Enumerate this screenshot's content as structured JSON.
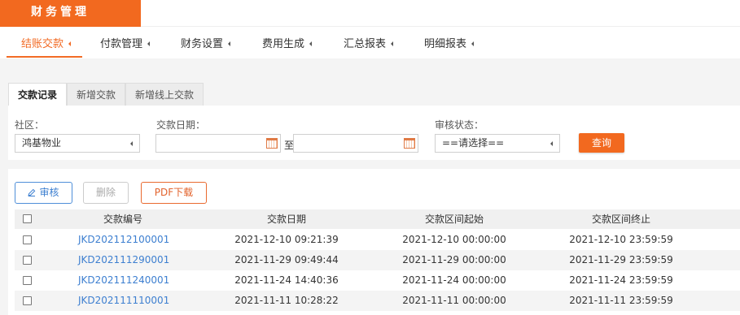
{
  "app": {
    "title": "财务管理"
  },
  "nav": {
    "items": [
      {
        "label": "结账交款",
        "active": true
      },
      {
        "label": "付款管理"
      },
      {
        "label": "财务设置"
      },
      {
        "label": "费用生成"
      },
      {
        "label": "汇总报表"
      },
      {
        "label": "明细报表"
      }
    ]
  },
  "tabs": [
    {
      "label": "交款记录",
      "active": true
    },
    {
      "label": "新增交款"
    },
    {
      "label": "新增线上交款"
    }
  ],
  "filters": {
    "community_label": "社区：",
    "community_value": "鸿基物业",
    "date_label": "交款日期：",
    "date_from": "",
    "date_to": "",
    "to_label": "至",
    "status_label": "审核状态：",
    "status_value": "==请选择==",
    "query_label": "查询"
  },
  "toolbar": {
    "audit_label": "审核",
    "delete_label": "删除",
    "pdf_label": "PDF下载"
  },
  "table": {
    "columns": [
      "交款编号",
      "交款日期",
      "交款区间起始",
      "交款区间终止"
    ],
    "rows": [
      {
        "id": "JKD202112100001",
        "date": "2021-12-10 09:21:39",
        "start": "2021-12-10 00:00:00",
        "end": "2021-12-10 23:59:59"
      },
      {
        "id": "JKD202111290001",
        "date": "2021-11-29 09:49:44",
        "start": "2021-11-29 00:00:00",
        "end": "2021-11-29 23:59:59"
      },
      {
        "id": "JKD202111240001",
        "date": "2021-11-24 14:40:36",
        "start": "2021-11-24 00:00:00",
        "end": "2021-11-24 23:59:59"
      },
      {
        "id": "JKD202111110001",
        "date": "2021-11-11 10:28:22",
        "start": "2021-11-11 00:00:00",
        "end": "2021-11-11 23:59:59"
      }
    ]
  },
  "colors": {
    "accent": "#f2691f",
    "link": "#3d7fd0",
    "audit_border": "#4f8fd9"
  },
  "icons": {
    "nav_caret": "caret-left-icon",
    "calendar": "calendar-icon",
    "edit": "pencil-icon"
  }
}
